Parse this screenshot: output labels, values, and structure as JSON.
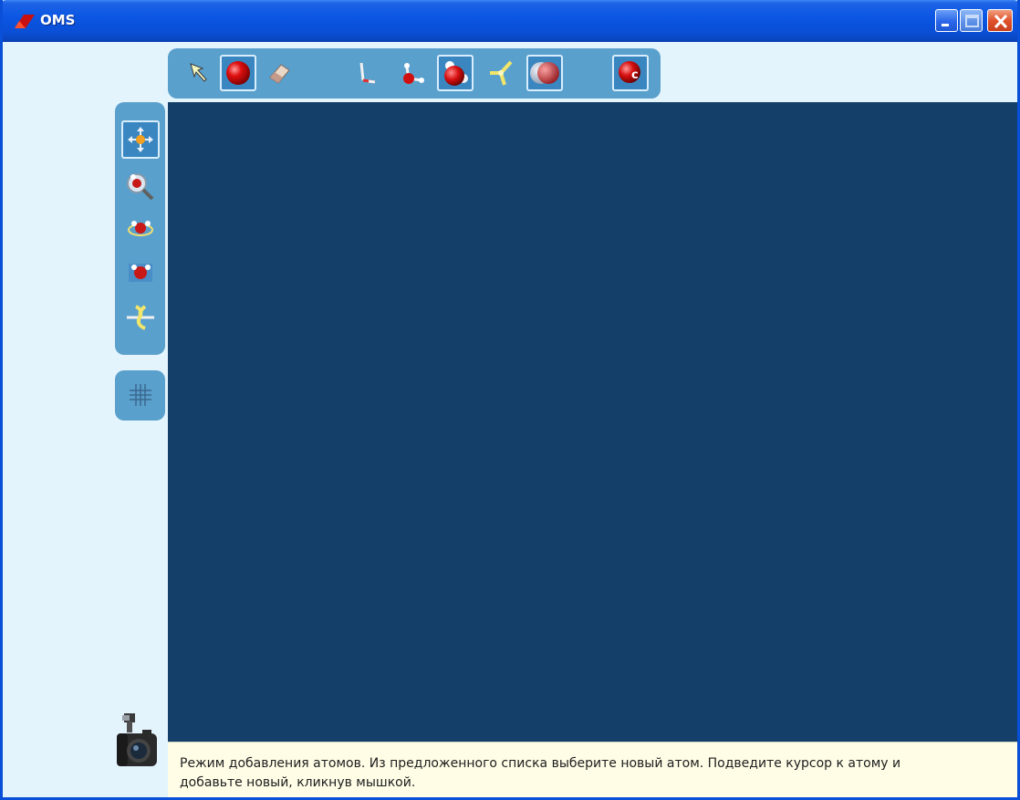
{
  "window": {
    "title": "OMS"
  },
  "top_toolbar": {
    "tools": [
      {
        "name": "select-arrow",
        "selected": false
      },
      {
        "name": "add-atom",
        "selected": true
      },
      {
        "name": "eraser",
        "selected": false
      },
      {
        "name": "bond-angle",
        "selected": false
      },
      {
        "name": "bond-stick",
        "selected": false
      },
      {
        "name": "molecule-ball",
        "selected": true
      },
      {
        "name": "trigonal-bonds",
        "selected": false
      },
      {
        "name": "space-filling",
        "selected": true
      },
      {
        "name": "atom-carbon",
        "selected": true
      }
    ],
    "carbon_label": "c"
  },
  "left_toolbar": {
    "tools": [
      {
        "name": "move-tool",
        "selected": true
      },
      {
        "name": "zoom-tool",
        "selected": false
      },
      {
        "name": "rotate-tool",
        "selected": false
      },
      {
        "name": "view-molecule",
        "selected": false
      },
      {
        "name": "rotate-bond",
        "selected": false
      }
    ],
    "grid_tool": "grid"
  },
  "status": {
    "line1": "Режим добавления атомов. Из предложенного списка выберите новый атом. Подведите курсор к атому и",
    "line2": "добавьте новый, кликнув мышкой."
  },
  "colors": {
    "canvas": "#143f69",
    "toolbar": "#5aa0cc",
    "background": "#e4f4fd",
    "titlebar": "#0a4fd6",
    "status_bg": "#fffde6"
  }
}
